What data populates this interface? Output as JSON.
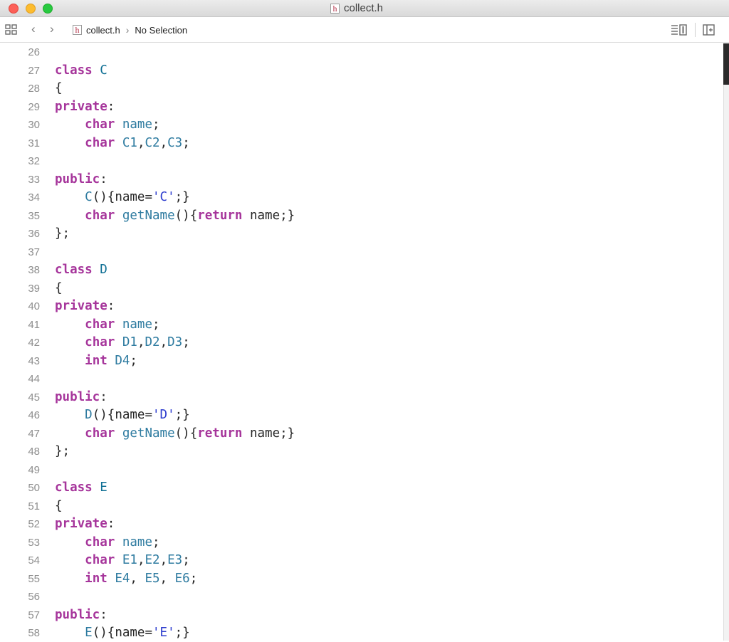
{
  "window": {
    "title": "collect.h",
    "file_badge": "h"
  },
  "jumpbar": {
    "back": "‹",
    "forward": "›",
    "file_badge": "h",
    "file_name": "collect.h",
    "separator": "›",
    "selection": "No Selection"
  },
  "editor": {
    "lines": [
      {
        "n": "26",
        "tokens": []
      },
      {
        "n": "27",
        "tokens": [
          {
            "t": "class",
            "c": "kw"
          },
          {
            "t": " ",
            "c": "punc"
          },
          {
            "t": "C",
            "c": "type"
          }
        ]
      },
      {
        "n": "28",
        "tokens": [
          {
            "t": "{",
            "c": "punc"
          }
        ]
      },
      {
        "n": "29",
        "tokens": [
          {
            "t": "private",
            "c": "kw"
          },
          {
            "t": ":",
            "c": "punc"
          }
        ]
      },
      {
        "n": "30",
        "tokens": [
          {
            "t": "    ",
            "c": "punc"
          },
          {
            "t": "char",
            "c": "kw"
          },
          {
            "t": " ",
            "c": "punc"
          },
          {
            "t": "name",
            "c": "ident"
          },
          {
            "t": ";",
            "c": "punc"
          }
        ]
      },
      {
        "n": "31",
        "tokens": [
          {
            "t": "    ",
            "c": "punc"
          },
          {
            "t": "char",
            "c": "kw"
          },
          {
            "t": " ",
            "c": "punc"
          },
          {
            "t": "C1",
            "c": "ident"
          },
          {
            "t": ",",
            "c": "punc"
          },
          {
            "t": "C2",
            "c": "ident"
          },
          {
            "t": ",",
            "c": "punc"
          },
          {
            "t": "C3",
            "c": "ident"
          },
          {
            "t": ";",
            "c": "punc"
          }
        ]
      },
      {
        "n": "32",
        "tokens": []
      },
      {
        "n": "33",
        "tokens": [
          {
            "t": "public",
            "c": "kw"
          },
          {
            "t": ":",
            "c": "punc"
          }
        ]
      },
      {
        "n": "34",
        "tokens": [
          {
            "t": "    ",
            "c": "punc"
          },
          {
            "t": "C",
            "c": "ident"
          },
          {
            "t": "(){",
            "c": "punc"
          },
          {
            "t": "name",
            "c": "punc"
          },
          {
            "t": "=",
            "c": "punc"
          },
          {
            "t": "'C'",
            "c": "str"
          },
          {
            "t": ";}",
            "c": "punc"
          }
        ]
      },
      {
        "n": "35",
        "tokens": [
          {
            "t": "    ",
            "c": "punc"
          },
          {
            "t": "char",
            "c": "kw"
          },
          {
            "t": " ",
            "c": "punc"
          },
          {
            "t": "getName",
            "c": "ident"
          },
          {
            "t": "(){",
            "c": "punc"
          },
          {
            "t": "return",
            "c": "kw"
          },
          {
            "t": " name;}",
            "c": "punc"
          }
        ]
      },
      {
        "n": "36",
        "tokens": [
          {
            "t": "};",
            "c": "punc"
          }
        ]
      },
      {
        "n": "37",
        "tokens": []
      },
      {
        "n": "38",
        "tokens": [
          {
            "t": "class",
            "c": "kw"
          },
          {
            "t": " ",
            "c": "punc"
          },
          {
            "t": "D",
            "c": "type"
          }
        ]
      },
      {
        "n": "39",
        "tokens": [
          {
            "t": "{",
            "c": "punc"
          }
        ]
      },
      {
        "n": "40",
        "tokens": [
          {
            "t": "private",
            "c": "kw"
          },
          {
            "t": ":",
            "c": "punc"
          }
        ]
      },
      {
        "n": "41",
        "tokens": [
          {
            "t": "    ",
            "c": "punc"
          },
          {
            "t": "char",
            "c": "kw"
          },
          {
            "t": " ",
            "c": "punc"
          },
          {
            "t": "name",
            "c": "ident"
          },
          {
            "t": ";",
            "c": "punc"
          }
        ]
      },
      {
        "n": "42",
        "tokens": [
          {
            "t": "    ",
            "c": "punc"
          },
          {
            "t": "char",
            "c": "kw"
          },
          {
            "t": " ",
            "c": "punc"
          },
          {
            "t": "D1",
            "c": "ident"
          },
          {
            "t": ",",
            "c": "punc"
          },
          {
            "t": "D2",
            "c": "ident"
          },
          {
            "t": ",",
            "c": "punc"
          },
          {
            "t": "D3",
            "c": "ident"
          },
          {
            "t": ";",
            "c": "punc"
          }
        ]
      },
      {
        "n": "43",
        "tokens": [
          {
            "t": "    ",
            "c": "punc"
          },
          {
            "t": "int",
            "c": "kw"
          },
          {
            "t": " ",
            "c": "punc"
          },
          {
            "t": "D4",
            "c": "ident"
          },
          {
            "t": ";",
            "c": "punc"
          }
        ]
      },
      {
        "n": "44",
        "tokens": []
      },
      {
        "n": "45",
        "tokens": [
          {
            "t": "public",
            "c": "kw"
          },
          {
            "t": ":",
            "c": "punc"
          }
        ]
      },
      {
        "n": "46",
        "tokens": [
          {
            "t": "    ",
            "c": "punc"
          },
          {
            "t": "D",
            "c": "ident"
          },
          {
            "t": "(){",
            "c": "punc"
          },
          {
            "t": "name",
            "c": "punc"
          },
          {
            "t": "=",
            "c": "punc"
          },
          {
            "t": "'D'",
            "c": "str"
          },
          {
            "t": ";}",
            "c": "punc"
          }
        ]
      },
      {
        "n": "47",
        "tokens": [
          {
            "t": "    ",
            "c": "punc"
          },
          {
            "t": "char",
            "c": "kw"
          },
          {
            "t": " ",
            "c": "punc"
          },
          {
            "t": "getName",
            "c": "ident"
          },
          {
            "t": "(){",
            "c": "punc"
          },
          {
            "t": "return",
            "c": "kw"
          },
          {
            "t": " name;}",
            "c": "punc"
          }
        ]
      },
      {
        "n": "48",
        "tokens": [
          {
            "t": "};",
            "c": "punc"
          }
        ]
      },
      {
        "n": "49",
        "tokens": []
      },
      {
        "n": "50",
        "tokens": [
          {
            "t": "class",
            "c": "kw"
          },
          {
            "t": " ",
            "c": "punc"
          },
          {
            "t": "E",
            "c": "type"
          }
        ]
      },
      {
        "n": "51",
        "tokens": [
          {
            "t": "{",
            "c": "punc"
          }
        ]
      },
      {
        "n": "52",
        "tokens": [
          {
            "t": "private",
            "c": "kw"
          },
          {
            "t": ":",
            "c": "punc"
          }
        ]
      },
      {
        "n": "53",
        "tokens": [
          {
            "t": "    ",
            "c": "punc"
          },
          {
            "t": "char",
            "c": "kw"
          },
          {
            "t": " ",
            "c": "punc"
          },
          {
            "t": "name",
            "c": "ident"
          },
          {
            "t": ";",
            "c": "punc"
          }
        ]
      },
      {
        "n": "54",
        "tokens": [
          {
            "t": "    ",
            "c": "punc"
          },
          {
            "t": "char",
            "c": "kw"
          },
          {
            "t": " ",
            "c": "punc"
          },
          {
            "t": "E1",
            "c": "ident"
          },
          {
            "t": ",",
            "c": "punc"
          },
          {
            "t": "E2",
            "c": "ident"
          },
          {
            "t": ",",
            "c": "punc"
          },
          {
            "t": "E3",
            "c": "ident"
          },
          {
            "t": ";",
            "c": "punc"
          }
        ]
      },
      {
        "n": "55",
        "tokens": [
          {
            "t": "    ",
            "c": "punc"
          },
          {
            "t": "int",
            "c": "kw"
          },
          {
            "t": " ",
            "c": "punc"
          },
          {
            "t": "E4",
            "c": "ident"
          },
          {
            "t": ", ",
            "c": "punc"
          },
          {
            "t": "E5",
            "c": "ident"
          },
          {
            "t": ", ",
            "c": "punc"
          },
          {
            "t": "E6",
            "c": "ident"
          },
          {
            "t": ";",
            "c": "punc"
          }
        ]
      },
      {
        "n": "56",
        "tokens": []
      },
      {
        "n": "57",
        "tokens": [
          {
            "t": "public",
            "c": "kw"
          },
          {
            "t": ":",
            "c": "punc"
          }
        ]
      },
      {
        "n": "58",
        "tokens": [
          {
            "t": "    ",
            "c": "punc"
          },
          {
            "t": "E",
            "c": "ident"
          },
          {
            "t": "(){",
            "c": "punc"
          },
          {
            "t": "name",
            "c": "punc"
          },
          {
            "t": "=",
            "c": "punc"
          },
          {
            "t": "'E'",
            "c": "str"
          },
          {
            "t": ";}",
            "c": "punc"
          }
        ]
      }
    ]
  },
  "colors": {
    "keyword": "#a6359b",
    "type_name": "#0f6f94",
    "identifier": "#2e7ba0",
    "string": "#2d3dce",
    "line_number": "#8e8e8e"
  }
}
